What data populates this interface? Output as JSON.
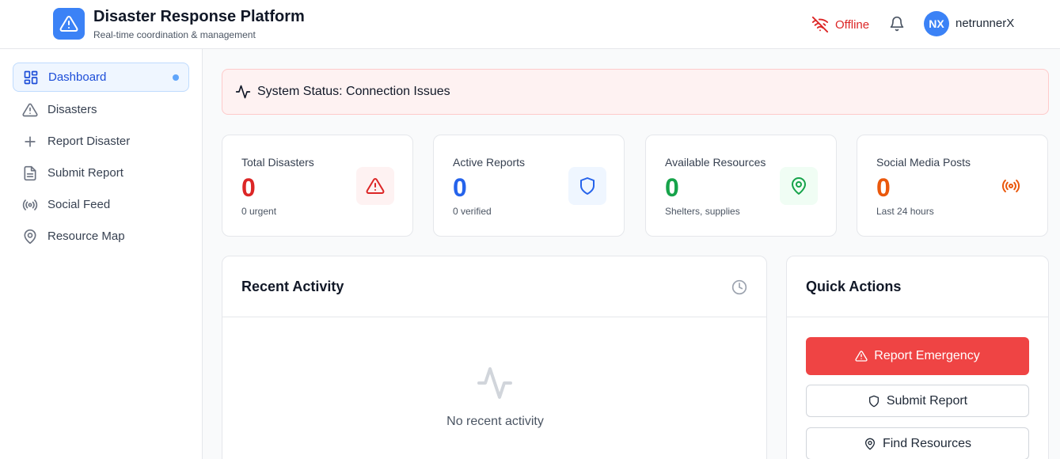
{
  "header": {
    "title": "Disaster Response Platform",
    "subtitle": "Real-time coordination & management",
    "connection_status": "Offline",
    "user_initials": "NX",
    "username": "netrunnerX"
  },
  "sidebar": {
    "items": [
      {
        "label": "Dashboard",
        "icon": "dashboard-icon",
        "active": true
      },
      {
        "label": "Disasters",
        "icon": "alert-triangle-icon"
      },
      {
        "label": "Report Disaster",
        "icon": "plus-icon"
      },
      {
        "label": "Submit Report",
        "icon": "document-icon"
      },
      {
        "label": "Social Feed",
        "icon": "broadcast-icon"
      },
      {
        "label": "Resource Map",
        "icon": "map-pin-icon"
      }
    ]
  },
  "status_banner": {
    "text": "System Status: Connection Issues"
  },
  "stats": [
    {
      "label": "Total Disasters",
      "value": "0",
      "sub": "0 urgent",
      "color": "#dc2626",
      "icon": "alert-triangle-icon"
    },
    {
      "label": "Active Reports",
      "value": "0",
      "sub": "0 verified",
      "color": "#2563eb",
      "icon": "shield-icon"
    },
    {
      "label": "Available Resources",
      "value": "0",
      "sub": "Shelters, supplies",
      "color": "#16a34a",
      "icon": "map-pin-icon"
    },
    {
      "label": "Social Media Posts",
      "value": "0",
      "sub": "Last 24 hours",
      "color": "#ea580c",
      "icon": "broadcast-icon"
    }
  ],
  "recent_activity": {
    "title": "Recent Activity",
    "empty_text": "No recent activity"
  },
  "quick_actions": {
    "title": "Quick Actions",
    "buttons": [
      {
        "label": "Report Emergency",
        "icon": "alert-triangle-icon"
      },
      {
        "label": "Submit Report",
        "icon": "shield-icon"
      },
      {
        "label": "Find Resources",
        "icon": "map-pin-icon"
      }
    ]
  }
}
